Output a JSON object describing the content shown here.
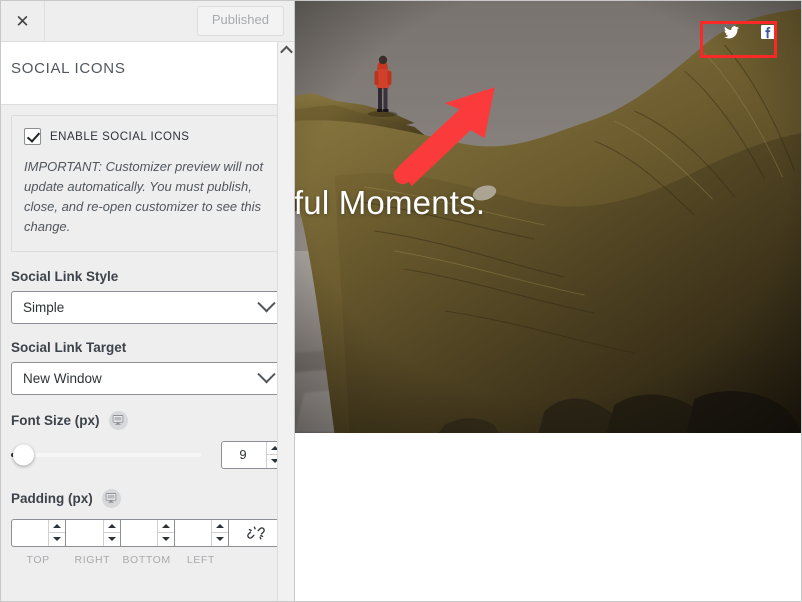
{
  "customizer": {
    "header": {
      "close_icon": "close-icon",
      "publish_label": "Published"
    },
    "section_title": "SOCIAL ICONS",
    "notice": {
      "checkbox_label": "ENABLE SOCIAL ICONS",
      "checkbox_checked": true,
      "text": "IMPORTANT: Customizer preview will not update automatically. You must publish, close, and re-open customizer to see this change."
    },
    "fields": [
      {
        "label": "Social Link Style",
        "value": "Simple",
        "type": "select"
      },
      {
        "label": "Social Link Target",
        "value": "New Window",
        "type": "select"
      }
    ],
    "font_size": {
      "label": "Font Size (px)",
      "value": "9",
      "responsive_icon": "desktop-monitor-icon",
      "slider_position_percent": 0
    },
    "padding": {
      "label": "Padding (px)",
      "responsive_icon": "desktop-monitor-icon",
      "values": [
        "",
        "",
        "",
        ""
      ],
      "sides": [
        "TOP",
        "RIGHT",
        "BOTTOM",
        "LEFT"
      ],
      "link_icon": "unlink-icon"
    }
  },
  "preview": {
    "hero_title": "tiful Moments.",
    "social_icons": [
      {
        "name": "twitter-icon",
        "label": "Twitter"
      },
      {
        "name": "facebook-icon",
        "label": "Facebook"
      }
    ]
  },
  "annotations": {
    "highlight_color": "#fb2828",
    "arrow_color": "#fb3b3b",
    "highlight_target": "social-icons-group",
    "arrow_points_to": "social-icons-group"
  }
}
